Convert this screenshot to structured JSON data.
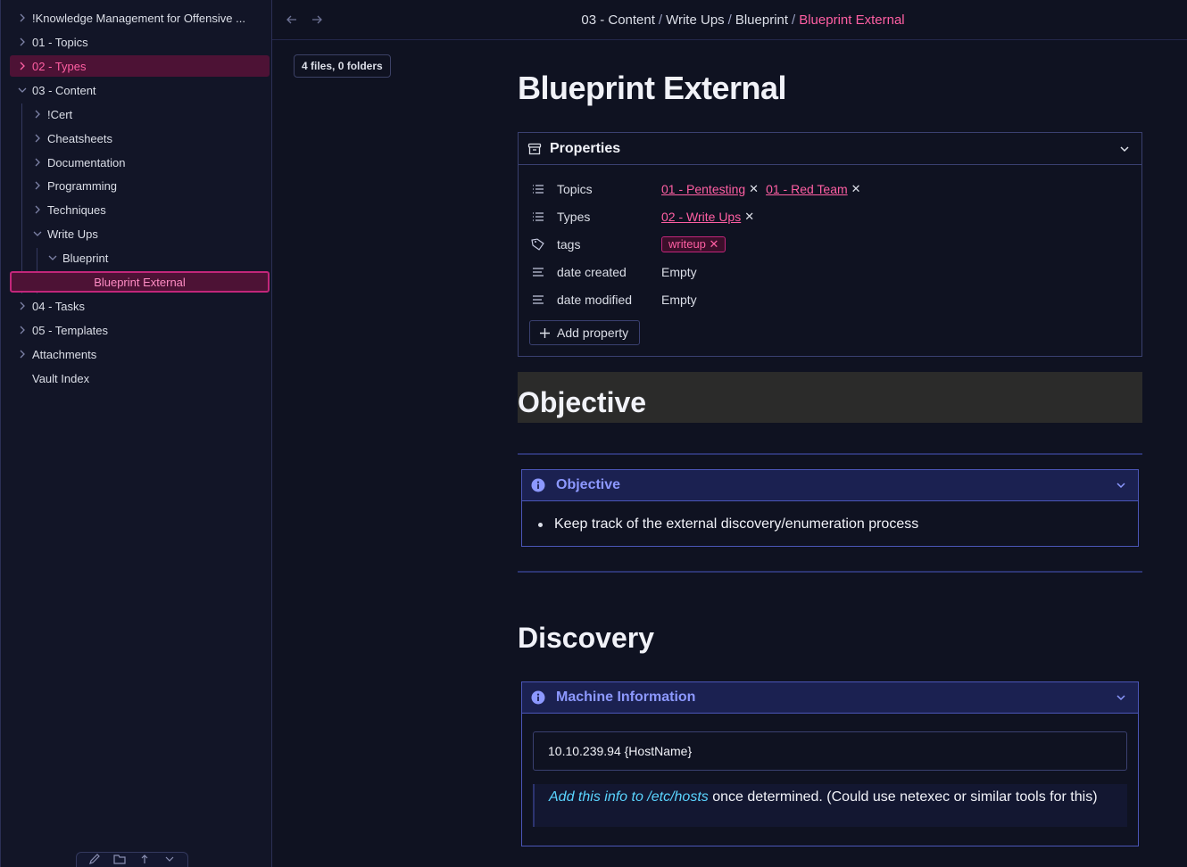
{
  "sidebar": {
    "items": [
      {
        "label": "!Knowledge Management for Offensive ...",
        "type": "folder",
        "expanded": false
      },
      {
        "label": "01 - Topics",
        "type": "folder",
        "expanded": false
      },
      {
        "label": "02 - Types",
        "type": "folder",
        "expanded": false,
        "active": true
      },
      {
        "label": "03 - Content",
        "type": "folder",
        "expanded": true
      },
      {
        "label": "!Cert",
        "type": "folder",
        "expanded": false
      },
      {
        "label": "Cheatsheets",
        "type": "folder",
        "expanded": false
      },
      {
        "label": "Documentation",
        "type": "folder",
        "expanded": false
      },
      {
        "label": "Programming",
        "type": "folder",
        "expanded": false
      },
      {
        "label": "Techniques",
        "type": "folder",
        "expanded": false
      },
      {
        "label": "Write Ups",
        "type": "folder",
        "expanded": true
      },
      {
        "label": "Blueprint",
        "type": "folder",
        "expanded": true
      },
      {
        "label": "Blueprint External",
        "type": "file",
        "active": true
      },
      {
        "label": "04 - Tasks",
        "type": "folder",
        "expanded": false
      },
      {
        "label": "05 - Templates",
        "type": "folder",
        "expanded": false
      },
      {
        "label": "Attachments",
        "type": "folder",
        "expanded": false
      },
      {
        "label": "Vault Index",
        "type": "file"
      }
    ]
  },
  "footer_icons": [
    "new-note-icon",
    "new-folder-icon",
    "sort-icon",
    "collapse-icon"
  ],
  "breadcrumb": {
    "parts": [
      "03 - Content",
      "Write Ups",
      "Blueprint"
    ],
    "separator": "/",
    "current": "Blueprint External"
  },
  "file_count": "4 files, 0 folders",
  "note": {
    "title": "Blueprint External",
    "properties": {
      "heading": "Properties",
      "rows": [
        {
          "key": "Topics",
          "icon": "list-icon",
          "values": [
            "01 - Pentesting",
            "01 - Red Team"
          ]
        },
        {
          "key": "Types",
          "icon": "list-icon",
          "values": [
            "02 - Write Ups"
          ]
        },
        {
          "key": "tags",
          "icon": "tag-icon",
          "values": [
            "writeup"
          ]
        },
        {
          "key": "date created",
          "icon": "text-icon",
          "value": "Empty"
        },
        {
          "key": "date modified",
          "icon": "text-icon",
          "value": "Empty"
        }
      ],
      "add_label": "Add property"
    },
    "objective_heading": "Objective",
    "objective_callout": {
      "title": "Objective",
      "bullet": "Keep track of the external discovery/enumeration process"
    },
    "discovery_heading": "Discovery",
    "machine_callout": {
      "title": "Machine Information",
      "code": "10.10.239.94 {HostName}",
      "quote_em": "Add this info to /etc/hosts",
      "quote_rest": " once determined. (Could use netexec or similar tools for this)"
    }
  },
  "colors": {
    "accent": "#ff5fa3",
    "callout": "#8c98ff",
    "link_italic": "#5ad4ff",
    "background": "#0f1221"
  }
}
